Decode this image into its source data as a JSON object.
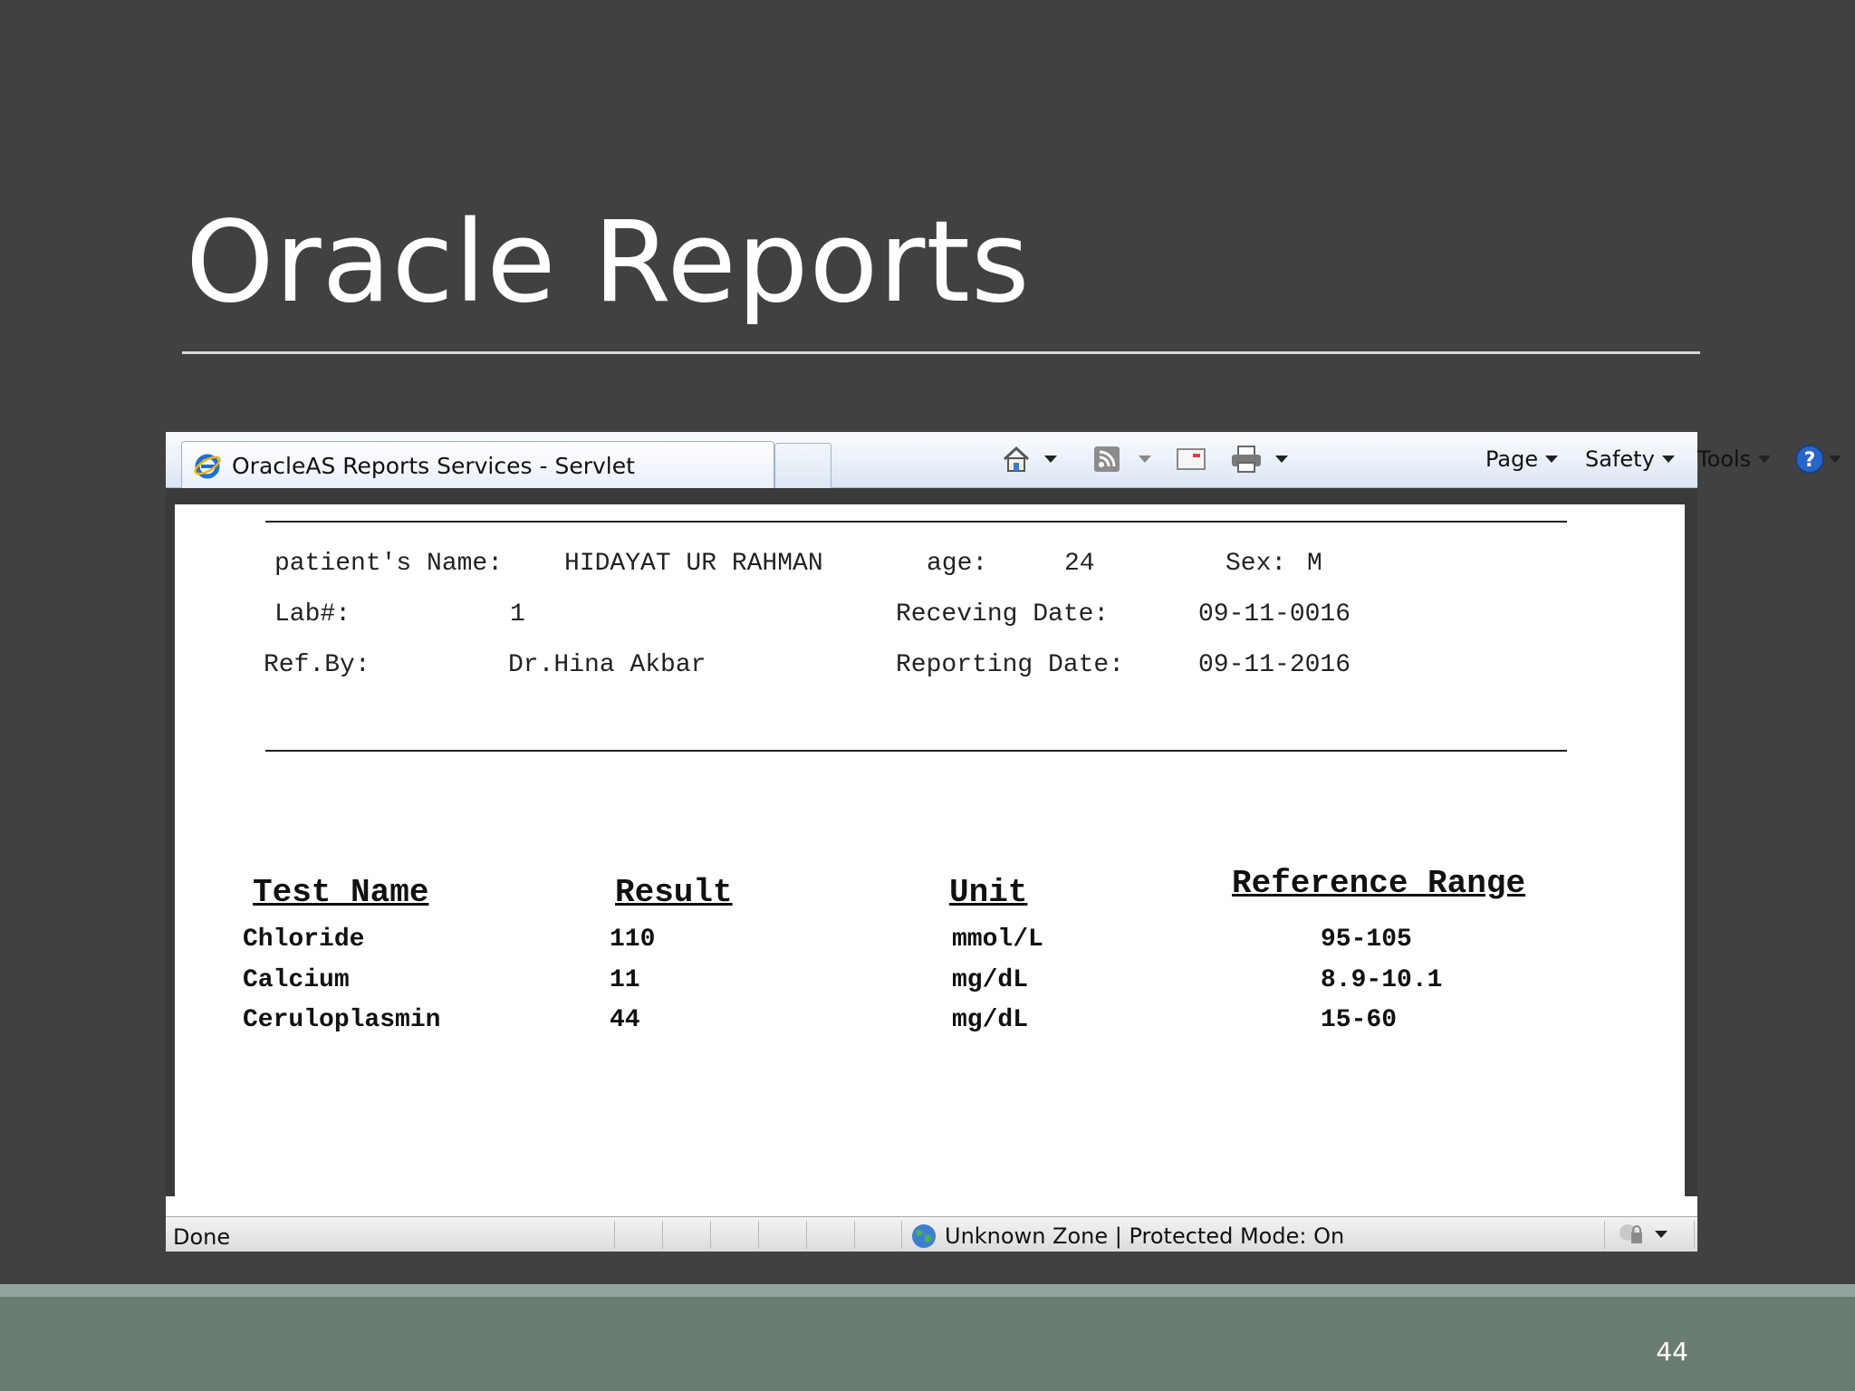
{
  "slide": {
    "title": "Oracle Reports",
    "page_number": "44"
  },
  "browser": {
    "tab_title": "OracleAS Reports Services - Servlet",
    "commands": {
      "page": "Page",
      "safety": "Safety",
      "tools": "Tools"
    },
    "status": {
      "text": "Done",
      "zone": "Unknown Zone | Protected Mode: On"
    }
  },
  "report": {
    "patient_name_label": "patient's Name:",
    "patient_name": "HIDAYAT UR RAHMAN",
    "age_label": "age:",
    "age": "24",
    "sex_label": "Sex:",
    "sex": "M",
    "lab_label": "Lab#:",
    "lab": "1",
    "receiving_label": "Receving Date:",
    "receiving_date": "09-11-0016",
    "ref_label": "Ref.By:",
    "ref_by": "Dr.Hina Akbar",
    "reporting_label": "Reporting Date:",
    "reporting_date": "09-11-2016",
    "headers": {
      "test": "Test Name",
      "result": "Result",
      "unit": "Unit",
      "range": "Reference Range"
    },
    "rows": [
      {
        "test": "Chloride",
        "result": "110",
        "unit": "mmol/L",
        "range": "95-105"
      },
      {
        "test": "Calcium",
        "result": "11",
        "unit": "mg/dL",
        "range": "8.9-10.1"
      },
      {
        "test": "Ceruloplasmin",
        "result": "44",
        "unit": "mg/dL",
        "range": "15-60"
      }
    ]
  }
}
